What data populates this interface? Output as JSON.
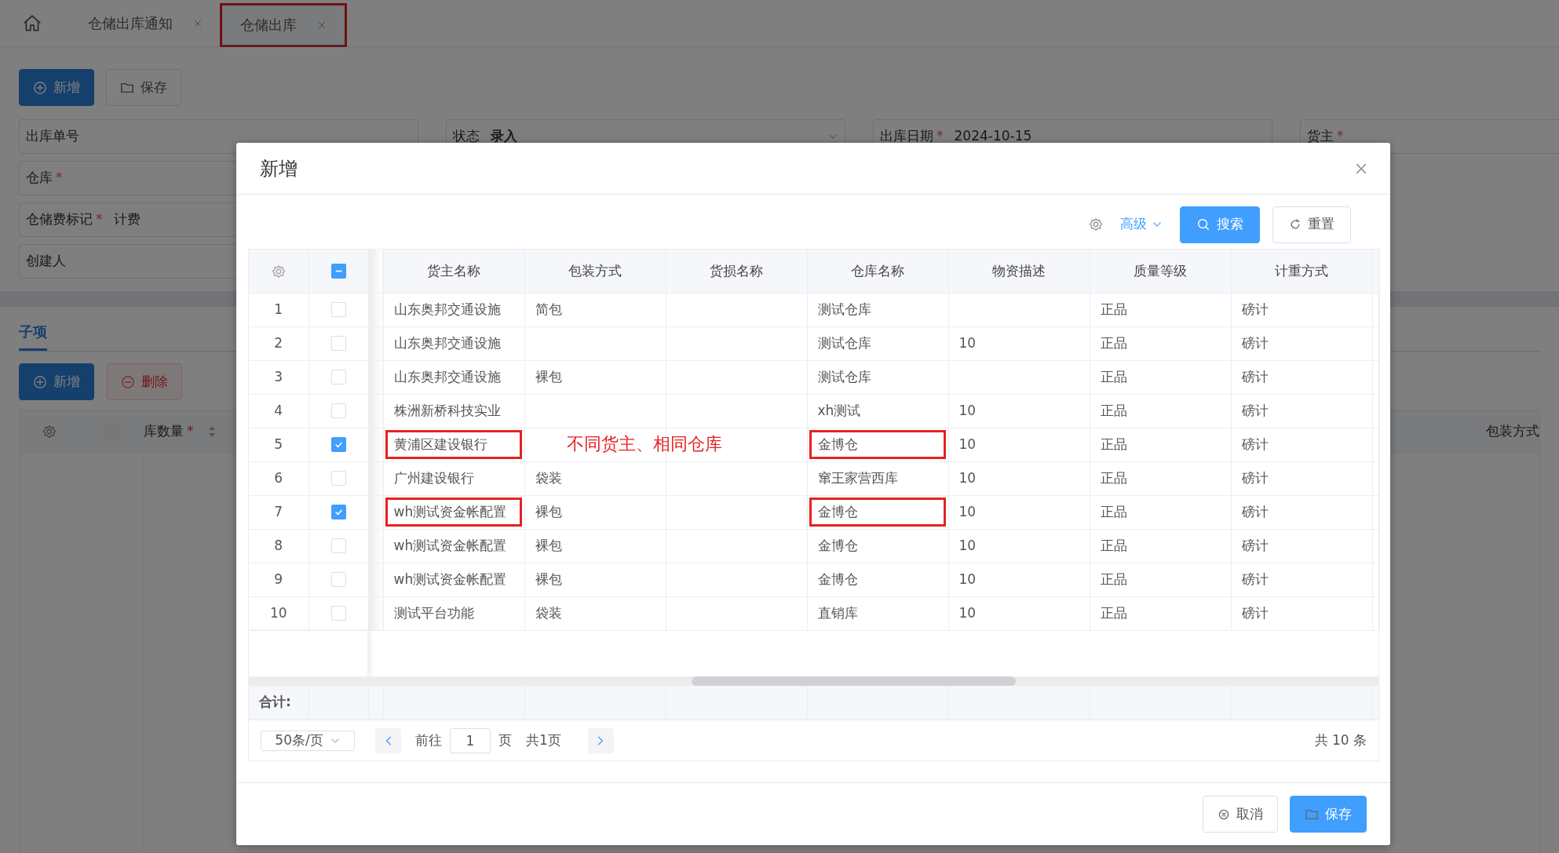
{
  "tabs": [
    {
      "label": "仓储出库通知",
      "selected": false,
      "highlighted": false
    },
    {
      "label": "仓储出库",
      "selected": true,
      "highlighted": true
    }
  ],
  "toolbar": [
    {
      "label": "新增",
      "kind": "add"
    },
    {
      "label": "保存",
      "kind": "save"
    }
  ],
  "form_rows": [
    [
      {
        "label": "出库单号",
        "kind": "text"
      },
      {
        "label": "状态",
        "value": "录入",
        "kind": "select"
      },
      {
        "label": "出库日期",
        "required_mark": "*",
        "value": "2024-10-15",
        "kind": "text"
      },
      {
        "label": "货主",
        "required_mark": "*",
        "kind": "text"
      }
    ],
    [
      {
        "label": "仓库",
        "required_mark": "*",
        "kind": "text"
      }
    ],
    [
      {
        "label": "仓储费标记",
        "required_mark": "*",
        "value": "计费",
        "kind": "text"
      }
    ],
    [
      {
        "label": "创建人",
        "kind": "text"
      }
    ]
  ],
  "section_tabs": [
    {
      "label": "子项",
      "selected": true
    }
  ],
  "sub_buttons": [
    {
      "label": "新增",
      "kind": "add",
      "disabled": false
    },
    {
      "label": "删除",
      "kind": "delete",
      "disabled": true
    }
  ],
  "sub_table": {
    "select_all": {
      "checked": false
    },
    "columns": [
      {
        "label": "库数量",
        "required_mark": "*",
        "sortable": true
      },
      {
        "label": "包装方式",
        "sortable": false
      }
    ]
  },
  "dialog": {
    "title": "新增",
    "toolbar": {
      "advanced": "高级",
      "search": "搜索",
      "reset": "重置"
    },
    "table": {
      "select_all": {
        "indeterminate": true
      },
      "columns": [
        "货主名称",
        "包装方式",
        "货损名称",
        "仓库名称",
        "物资描述",
        "质量等级",
        "计重方式"
      ],
      "rows": [
        {
          "index": "1",
          "selected": false,
          "cells": [
            {
              "text": "山东奥邦交通设施",
              "highlighted": false
            },
            {
              "text": "简包",
              "highlighted": false
            },
            {
              "highlighted": false
            },
            {
              "text": "测试仓库",
              "highlighted": false
            },
            {
              "highlighted": false
            },
            {
              "text": "正品",
              "highlighted": false
            },
            {
              "text": "磅计",
              "highlighted": false
            }
          ]
        },
        {
          "index": "2",
          "selected": false,
          "cells": [
            {
              "text": "山东奥邦交通设施",
              "highlighted": false
            },
            {
              "highlighted": false
            },
            {
              "highlighted": false
            },
            {
              "text": "测试仓库",
              "highlighted": false
            },
            {
              "text": "10",
              "highlighted": false
            },
            {
              "text": "正品",
              "highlighted": false
            },
            {
              "text": "磅计",
              "highlighted": false
            }
          ]
        },
        {
          "index": "3",
          "selected": false,
          "cells": [
            {
              "text": "山东奥邦交通设施",
              "highlighted": false
            },
            {
              "text": "裸包",
              "highlighted": false
            },
            {
              "highlighted": false
            },
            {
              "text": "测试仓库",
              "highlighted": false
            },
            {
              "highlighted": false
            },
            {
              "text": "正品",
              "highlighted": false
            },
            {
              "text": "磅计",
              "highlighted": false
            }
          ]
        },
        {
          "index": "4",
          "selected": false,
          "cells": [
            {
              "text": "株洲新桥科技实业",
              "highlighted": false
            },
            {
              "highlighted": false
            },
            {
              "highlighted": false
            },
            {
              "text": "xh测试",
              "highlighted": false
            },
            {
              "text": "10",
              "highlighted": false
            },
            {
              "text": "正品",
              "highlighted": false
            },
            {
              "text": "磅计",
              "highlighted": false
            }
          ]
        },
        {
          "index": "5",
          "selected": true,
          "cells": [
            {
              "text": "黄浦区建设银行",
              "highlighted": true
            },
            {
              "highlighted": false
            },
            {
              "highlighted": false
            },
            {
              "text": "金博仓",
              "highlighted": true
            },
            {
              "text": "10",
              "highlighted": false
            },
            {
              "text": "正品",
              "highlighted": false
            },
            {
              "text": "磅计",
              "highlighted": false
            }
          ]
        },
        {
          "index": "6",
          "selected": false,
          "cells": [
            {
              "text": "广州建设银行",
              "highlighted": false
            },
            {
              "text": "袋装",
              "highlighted": false
            },
            {
              "highlighted": false
            },
            {
              "text": "窜王家营西库",
              "highlighted": false
            },
            {
              "text": "10",
              "highlighted": false
            },
            {
              "text": "正品",
              "highlighted": false
            },
            {
              "text": "磅计",
              "highlighted": false
            }
          ]
        },
        {
          "index": "7",
          "selected": true,
          "cells": [
            {
              "text": "wh测试资金帐配置",
              "highlighted": true
            },
            {
              "text": "裸包",
              "highlighted": false
            },
            {
              "highlighted": false
            },
            {
              "text": "金博仓",
              "highlighted": true
            },
            {
              "text": "10",
              "highlighted": false
            },
            {
              "text": "正品",
              "highlighted": false
            },
            {
              "text": "磅计",
              "highlighted": false
            }
          ]
        },
        {
          "index": "8",
          "selected": false,
          "cells": [
            {
              "text": "wh测试资金帐配置",
              "highlighted": false
            },
            {
              "text": "裸包",
              "highlighted": false
            },
            {
              "highlighted": false
            },
            {
              "text": "金博仓",
              "highlighted": false
            },
            {
              "text": "10",
              "highlighted": false
            },
            {
              "text": "正品",
              "highlighted": false
            },
            {
              "text": "磅计",
              "highlighted": false
            }
          ]
        },
        {
          "index": "9",
          "selected": false,
          "cells": [
            {
              "text": "wh测试资金帐配置",
              "highlighted": false
            },
            {
              "text": "裸包",
              "highlighted": false
            },
            {
              "highlighted": false
            },
            {
              "text": "金博仓",
              "highlighted": false
            },
            {
              "text": "10",
              "highlighted": false
            },
            {
              "text": "正品",
              "highlighted": false
            },
            {
              "text": "磅计",
              "highlighted": false
            }
          ]
        },
        {
          "index": "10",
          "selected": false,
          "cells": [
            {
              "text": "测试平台功能",
              "highlighted": false
            },
            {
              "text": "袋装",
              "highlighted": false
            },
            {
              "highlighted": false
            },
            {
              "text": "直销库",
              "highlighted": false
            },
            {
              "text": "10",
              "highlighted": false
            },
            {
              "text": "正品",
              "highlighted": false
            },
            {
              "text": "磅计",
              "highlighted": false
            }
          ]
        }
      ],
      "annotation": "不同货主、相同仓库",
      "summary_label": "合计:"
    },
    "pagination": {
      "page_size": "50条/页",
      "goto": "前往",
      "page": "1",
      "page_unit": "页",
      "pages": "共1页",
      "total": "共 10 条"
    },
    "buttons": [
      {
        "label": "取消",
        "kind": "cancel"
      },
      {
        "label": "保存",
        "kind": "save"
      }
    ]
  }
}
